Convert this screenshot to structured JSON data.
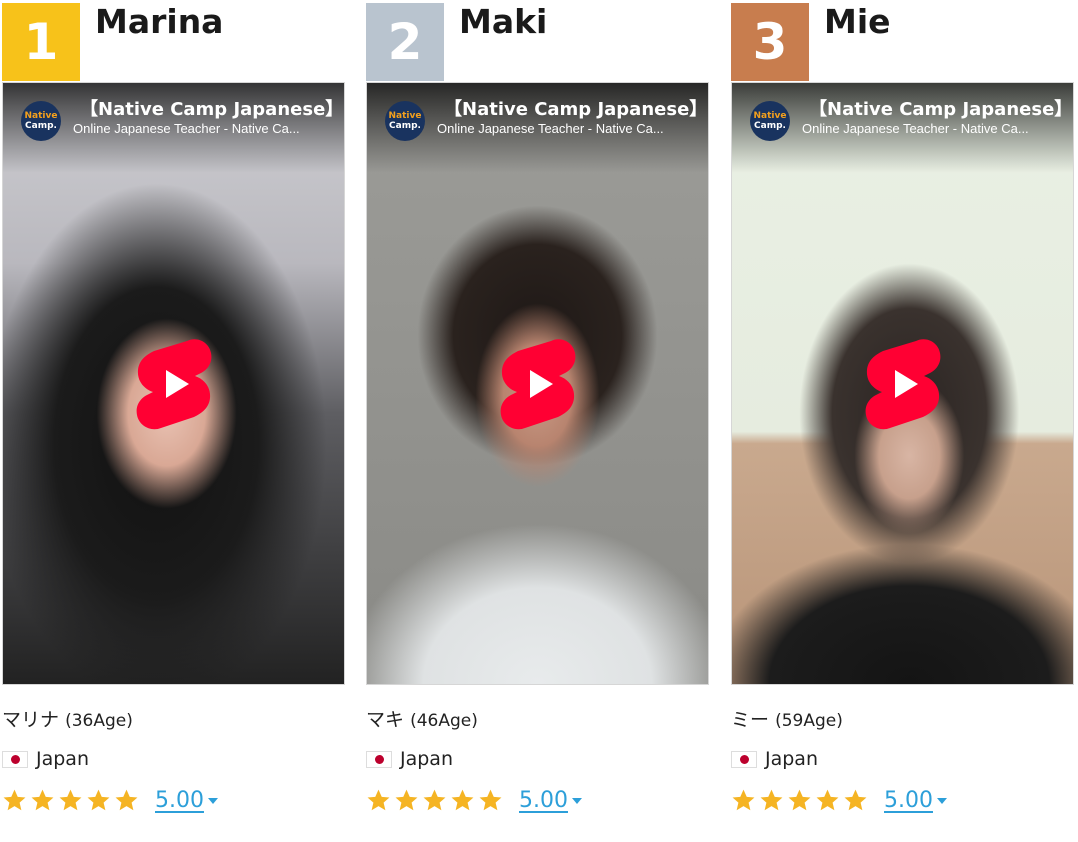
{
  "teachers": [
    {
      "rank": "1",
      "rank_color": "#f7c21a",
      "name": "Marina",
      "video": {
        "title": "【Native Camp Japanese】",
        "subtitle": "Online Japanese Teacher - Native Ca...",
        "channel_logo": [
          "Native",
          "Camp."
        ]
      },
      "jp_name": "マリナ",
      "age": "(36Age)",
      "country": "Japan",
      "rating": "5.00"
    },
    {
      "rank": "2",
      "rank_color": "#b9c4cf",
      "name": "Maki",
      "video": {
        "title": "【Native Camp Japanese】",
        "subtitle": "Online Japanese Teacher - Native Ca...",
        "channel_logo": [
          "Native",
          "Camp."
        ]
      },
      "jp_name": "マキ",
      "age": "(46Age)",
      "country": "Japan",
      "rating": "5.00"
    },
    {
      "rank": "3",
      "rank_color": "#c87d4e",
      "name": "Mie",
      "video": {
        "title": "【Native Camp Japanese】",
        "subtitle": "Online Japanese Teacher - Native Ca...",
        "channel_logo": [
          "Native",
          "Camp."
        ]
      },
      "jp_name": "ミー",
      "age": "(59Age)",
      "country": "Japan",
      "rating": "5.00"
    }
  ],
  "colors": {
    "star": "#f5b423",
    "link": "#2c9fd9",
    "play_button": "#ff0033"
  },
  "icons": {
    "play": "youtube-shorts-play-icon",
    "star": "star-icon",
    "flag": "japan-flag-icon",
    "caret": "caret-down-icon"
  }
}
